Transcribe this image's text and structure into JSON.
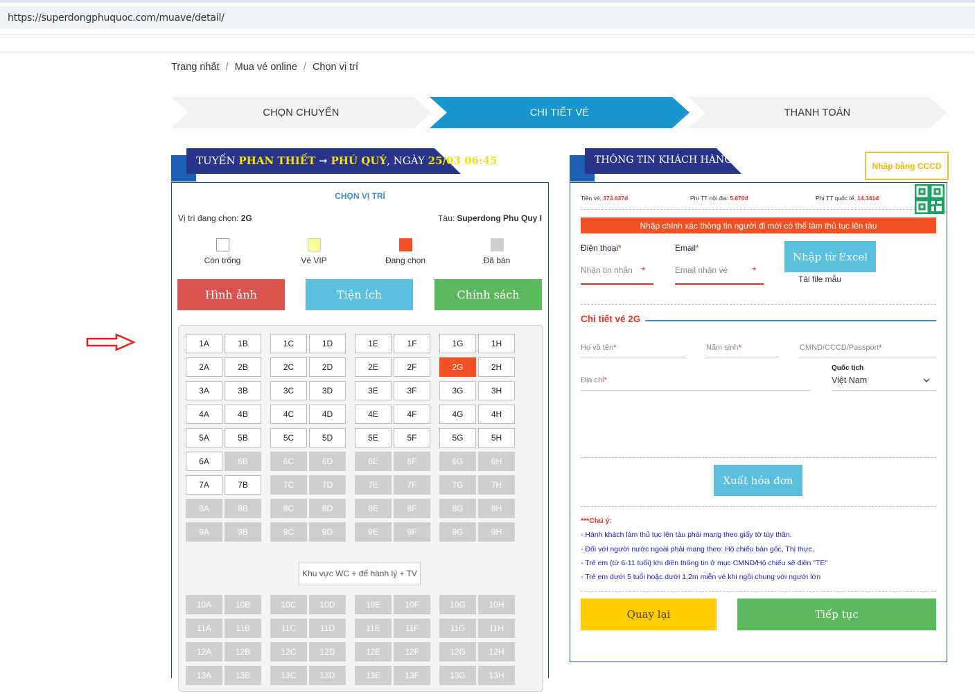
{
  "browser": {
    "url": "https://superdongphuquoc.com/muave/detail/"
  },
  "breadcrumb": [
    "Trang nhất",
    "Mua vé online",
    "Chọn vị trí"
  ],
  "breadcrumb_sep": "/",
  "steps": [
    "CHỌN CHUYẾN",
    "CHI TIẾT VÉ",
    "THANH TOÁN"
  ],
  "left": {
    "header": {
      "prefix": "TUYẾN ",
      "from": "PHAN THIẾT",
      "arrow": " ➞ ",
      "to": "PHÚ QUÝ",
      "mid": ", NGÀY ",
      "date": "25/03 06:45"
    },
    "title": "CHỌN VỊ TRÍ",
    "current_label": "Vị trí đang chọn: ",
    "current_value": "2G",
    "ship_label": "Tàu: ",
    "ship_value": "Superdong Phu Quy I",
    "legend": [
      {
        "label": "Còn trống",
        "color": "#ffffff"
      },
      {
        "label": "Vé VIP",
        "color": "#fdfd96"
      },
      {
        "label": "Đang chọn",
        "color": "#f05024"
      },
      {
        "label": "Đã bán",
        "color": "#cfcfcf"
      }
    ],
    "buttons": [
      {
        "label": "Hình ảnh",
        "color": "#d9534f"
      },
      {
        "label": "Tiện ích",
        "color": "#5bc0de"
      },
      {
        "label": "Chính sách",
        "color": "#5cb85c"
      }
    ],
    "columns": [
      "A",
      "B",
      "C",
      "D",
      "E",
      "F",
      "G",
      "H"
    ],
    "rows_front": [
      1,
      2,
      3,
      4,
      5,
      6,
      7,
      8,
      9
    ],
    "rows_back": [
      10,
      11,
      12,
      13
    ],
    "selected_seat": "2G",
    "available_seats": [
      "1A",
      "1B",
      "1C",
      "1D",
      "1E",
      "1F",
      "1G",
      "1H",
      "2A",
      "2B",
      "2C",
      "2D",
      "2E",
      "2F",
      "2H",
      "3A",
      "3B",
      "3C",
      "3D",
      "3E",
      "3F",
      "3G",
      "3H",
      "4A",
      "4B",
      "4C",
      "4D",
      "4E",
      "4F",
      "4G",
      "4H",
      "5A",
      "5B",
      "5C",
      "5D",
      "5E",
      "5F",
      "5G",
      "5H",
      "6A",
      "7A",
      "7B"
    ],
    "wc_zone": "Khu vực WC + để hành lý + TV"
  },
  "right": {
    "header": "THÔNG TIN KHÁCH HÀNG",
    "cccd_button": "Nhập bằng CCCD",
    "fees": [
      {
        "label": "Tiền vé: ",
        "value": "373.637đ"
      },
      {
        "label": "Phí TT nội địa: ",
        "value": "5.870đ"
      },
      {
        "label": "Phí TT quốc tế: ",
        "value": "14.341đ"
      }
    ],
    "warning": "Nhập chính xác thông tin người đi mới có thể làm thủ tục lên tàu",
    "phone_label": "Điện thoại",
    "phone_placeholder": "Nhận tin nhắn",
    "email_label": "Email",
    "email_placeholder": "Email nhận vé",
    "required_mark": "*",
    "excel_button": "Nhập từ Excel",
    "template_link": "Tải file mẫu",
    "ticket_detail": "Chi tiết vé 2G",
    "fullname_label": "Họ và tên",
    "birthyear_label": "Năm sinh",
    "id_label": "CMND/CCCD/Passport",
    "address_label": "Địa chỉ",
    "nationality_label": "Quốc tịch",
    "nationality_value": "Việt Nam",
    "invoice_button": "Xuất hóa đơn",
    "notes_title": "***Chú ý:",
    "notes": [
      "- Hành khách làm thủ tục lên tàu phải mang theo giấy tờ tùy thân.",
      "- Đối với người nước ngoài phải mang theo: Hộ chiếu bản gốc, Thị thực.",
      "- Trẻ em (từ 6-11 tuổi) khi điền thông tin ở mục CMND/Hộ chiếu sẽ điền \"TE\"",
      "- Trẻ em dưới 5 tuổi hoặc dưới 1,2m miễn vé khi ngồi chung với người lớn"
    ],
    "back_button": "Quay lại",
    "next_button": "Tiếp tục"
  },
  "colors": {
    "step_active": "#1796cf",
    "step_inactive": "#f2f2f2",
    "header_bg": "#2a3589",
    "accent_red": "#f05024"
  },
  "icons": {
    "arrow": "right-arrow-icon",
    "qr": "qr-code-icon",
    "chevron": "chevron-down-icon"
  }
}
